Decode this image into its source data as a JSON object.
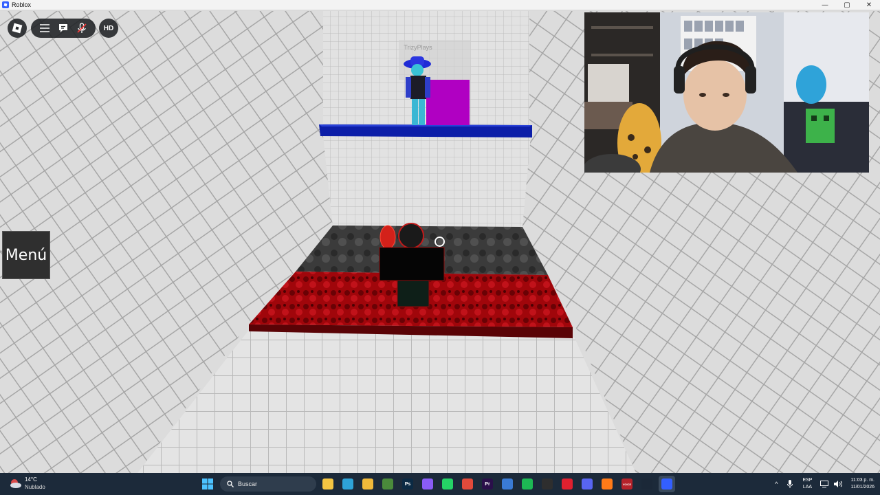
{
  "window": {
    "title": "Roblox",
    "controls": {
      "minimize": "—",
      "maximize": "▢",
      "close": "✕"
    }
  },
  "hud": {
    "roblox_icon": "roblox-logo-icon",
    "menu_icon": "hamburger-icon",
    "chat_icon": "chat-icon",
    "mic_icon": "microphone-muted-icon",
    "hd_label": "HD"
  },
  "game": {
    "menu_label": "Menú",
    "player_name": "TrizyPlays"
  },
  "taskbar": {
    "weather": {
      "temp": "14°C",
      "condition": "Nublado"
    },
    "search_placeholder": "Buscar",
    "apps": [
      {
        "name": "file-explorer-icon",
        "color": "#f4c542"
      },
      {
        "name": "edge-icon",
        "color": "#2ea3d8"
      },
      {
        "name": "folder-icon",
        "color": "#f0b93a"
      },
      {
        "name": "minecraft-icon",
        "color": "#4a8a3b"
      },
      {
        "name": "photoshop-icon",
        "color": "#0b2a44",
        "text": "Ps"
      },
      {
        "name": "copilot-icon",
        "color": "#8a5cf6"
      },
      {
        "name": "whatsapp-icon",
        "color": "#25d366"
      },
      {
        "name": "chrome-icon",
        "color": "#e24a3b"
      },
      {
        "name": "premiere-icon",
        "color": "#2a0f4a",
        "text": "Pr"
      },
      {
        "name": "store-icon",
        "color": "#3a7bd5"
      },
      {
        "name": "spotify-icon",
        "color": "#1db954"
      },
      {
        "name": "obs-icon",
        "color": "#2e2e2e"
      },
      {
        "name": "opera-icon",
        "color": "#e0202f"
      },
      {
        "name": "discord-icon",
        "color": "#5865f2"
      },
      {
        "name": "firefox-icon",
        "color": "#ff7a18"
      },
      {
        "name": "voicemeeter-icon",
        "color": "#b5222a",
        "text": "VOICE"
      },
      {
        "name": "steam-icon",
        "color": "#1b2838"
      },
      {
        "name": "roblox-icon",
        "color": "#335fff",
        "active": true
      }
    ],
    "language": {
      "top": "ESP",
      "bottom": "LAA"
    },
    "clock": {
      "time": "11:03 p. m.",
      "date": "11/01/2026"
    }
  }
}
